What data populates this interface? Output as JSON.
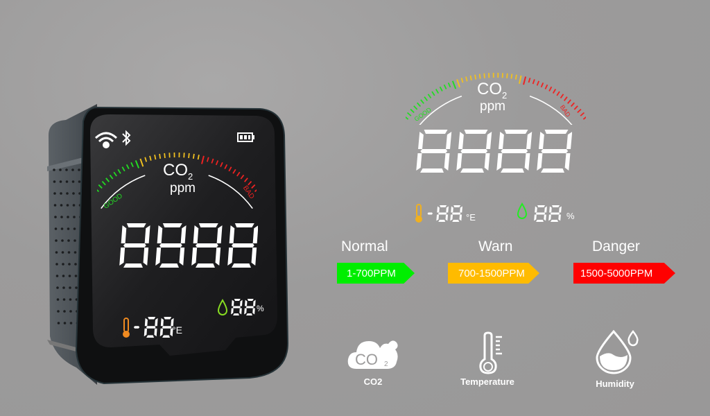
{
  "device": {
    "gauge": {
      "title": "CO",
      "subscript": "2",
      "unit": "ppm",
      "good_label": "GOOD",
      "bad_label": "BAD"
    },
    "main_readout": "8888",
    "temperature": {
      "sign": "-",
      "value": "88",
      "unit": "°E"
    },
    "humidity": {
      "value": "88",
      "unit": "%"
    },
    "status_icons": [
      "wifi-icon",
      "bluetooth-icon",
      "battery-icon"
    ]
  },
  "display_panel": {
    "gauge": {
      "title": "CO",
      "subscript": "2",
      "unit": "ppm",
      "good_label": "GOOD",
      "bad_label": "BAD"
    },
    "main_readout": "8888",
    "temperature": {
      "sign": "-",
      "value": "88",
      "unit": "°E"
    },
    "humidity": {
      "value": "88",
      "unit": "%"
    }
  },
  "levels": [
    {
      "name": "Normal",
      "range": "1-700PPM",
      "color": "#00ee00"
    },
    {
      "name": "Warn",
      "range": "700-1500PPM",
      "color": "#ffbb00"
    },
    {
      "name": "Danger",
      "range": "1500-5000PPM",
      "color": "#ff0000"
    }
  ],
  "features": [
    {
      "label": "CO2",
      "icon": "co2-cloud-icon",
      "icon_text": "CO",
      "icon_sub": "2"
    },
    {
      "label": "Temperature",
      "icon": "thermometer-icon"
    },
    {
      "label": "Humidity",
      "icon": "humidity-drop-icon"
    }
  ],
  "colors": {
    "good": "#22dd22",
    "warn": "#f0c020",
    "bad": "#ee2222",
    "temp_icon": "#f08a20",
    "humid_icon": "#88dd22"
  }
}
